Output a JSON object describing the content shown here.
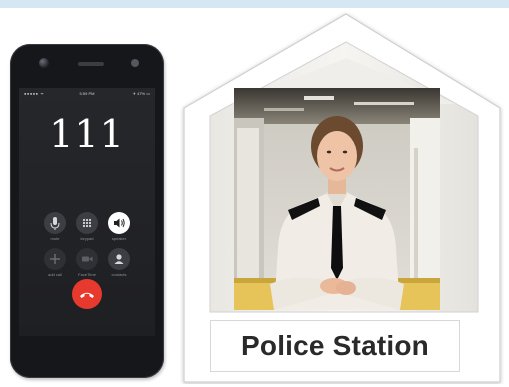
{
  "phone": {
    "status_bar": {
      "signal": "●●●●● ᯤ",
      "time": "5:59 PM",
      "battery": "✈ 47% ▭"
    },
    "dialed_number": "111",
    "buttons": {
      "mute": "mute",
      "keypad": "keypad",
      "speaker": "speaker",
      "add_call": "add call",
      "facetime": "FaceTime",
      "contacts": "contacts"
    },
    "icons": [
      "microphone-icon",
      "keypad-icon",
      "speaker-icon",
      "plus-icon",
      "video-icon",
      "contact-icon",
      "hang-up-icon"
    ]
  },
  "house": {
    "sign_text": "Police Station"
  },
  "colors": {
    "end_call": "#e8392e",
    "top_band": "#d4e7f3",
    "frame": "#ffffff",
    "shirt": "#f1ede6",
    "tie": "#0e0e10"
  }
}
